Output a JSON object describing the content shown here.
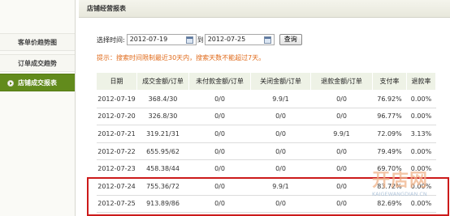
{
  "sidebar": {
    "items": [
      {
        "label": "客单价趋势图"
      },
      {
        "label": "订单成交趋势"
      },
      {
        "label": "店铺成交报表"
      }
    ]
  },
  "main": {
    "title": "店铺经营报表"
  },
  "filter": {
    "label": "选择时间:",
    "start_date": "2012-07-19",
    "separator": "到",
    "end_date": "2012-07-25",
    "query_label": "查询"
  },
  "hint": "提示：搜索时间限制最近30天内，搜索天数不能超过7天。",
  "table": {
    "headers": [
      "日期",
      "成交金额/订单",
      "未付款金额/订单",
      "关闭金额/订单",
      "退款金额/订单",
      "支付率",
      "退款率"
    ],
    "rows": [
      [
        "2012-07-19",
        "368.4/30",
        "0/0",
        "9.9/1",
        "0/0",
        "76.92%",
        "0.00%"
      ],
      [
        "2012-07-20",
        "326.8/30",
        "0/0",
        "0/0",
        "0/0",
        "96.77%",
        "0.00%"
      ],
      [
        "2012-07-21",
        "319.21/31",
        "0/0",
        "0/0",
        "9.9/1",
        "72.09%",
        "3.13%"
      ],
      [
        "2012-07-22",
        "655.95/62",
        "0/0",
        "0/0",
        "0/0",
        "79.49%",
        "0.00%"
      ],
      [
        "2012-07-23",
        "458.38/44",
        "0/0",
        "0/0",
        "0/0",
        "69.70%",
        "0.00%"
      ],
      [
        "2012-07-24",
        "755.36/72",
        "0/0",
        "9.9/1",
        "0/0",
        "83.72%",
        "0.00%"
      ],
      [
        "2012-07-25",
        "913.89/86",
        "0/0",
        "0/0",
        "0/0",
        "82.69%",
        "0.00%"
      ]
    ]
  },
  "watermark": {
    "logo_text": "开店网",
    "url_text": "KAIGEWANGDIAN.CN"
  },
  "colors": {
    "sidebar_active": "#628b1c",
    "hint": "#e06a1a",
    "highlight_border": "#cc1a1a",
    "header_bg": "#eef2e6"
  }
}
